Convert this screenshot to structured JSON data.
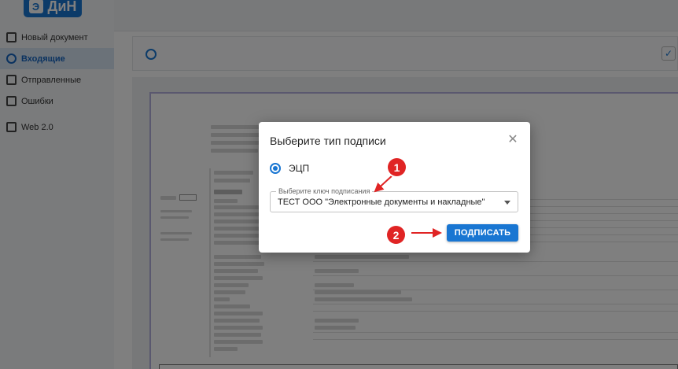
{
  "app": {
    "logo_text": "ДиН",
    "logo_mark": "Э"
  },
  "sidebar": {
    "items": [
      {
        "label": "Новый документ"
      },
      {
        "label": "Входящие"
      },
      {
        "label": "Отправленные"
      },
      {
        "label": "Ошибки"
      },
      {
        "label": "Web 2.0"
      }
    ]
  },
  "dialog": {
    "title": "Выберите тип подписи",
    "close_glyph": "✕",
    "option_label": "ЭЦП",
    "key_select": {
      "label": "Выберите ключ подписания",
      "value": "ТЕСТ ООО \"Электронные документы и накладные\""
    },
    "sign_button": "ПОДПИСАТЬ"
  },
  "annotations": {
    "step1": "1",
    "step2": "2",
    "color": "#e02424"
  },
  "colors": {
    "accent": "#1976d2",
    "active_nav_bg": "#d6e4f3"
  },
  "icons": [
    "new-document-icon",
    "inbox-icon",
    "sent-icon",
    "errors-icon",
    "web-icon",
    "info-icon",
    "check-icon",
    "close-icon",
    "dropdown-arrow-icon"
  ]
}
